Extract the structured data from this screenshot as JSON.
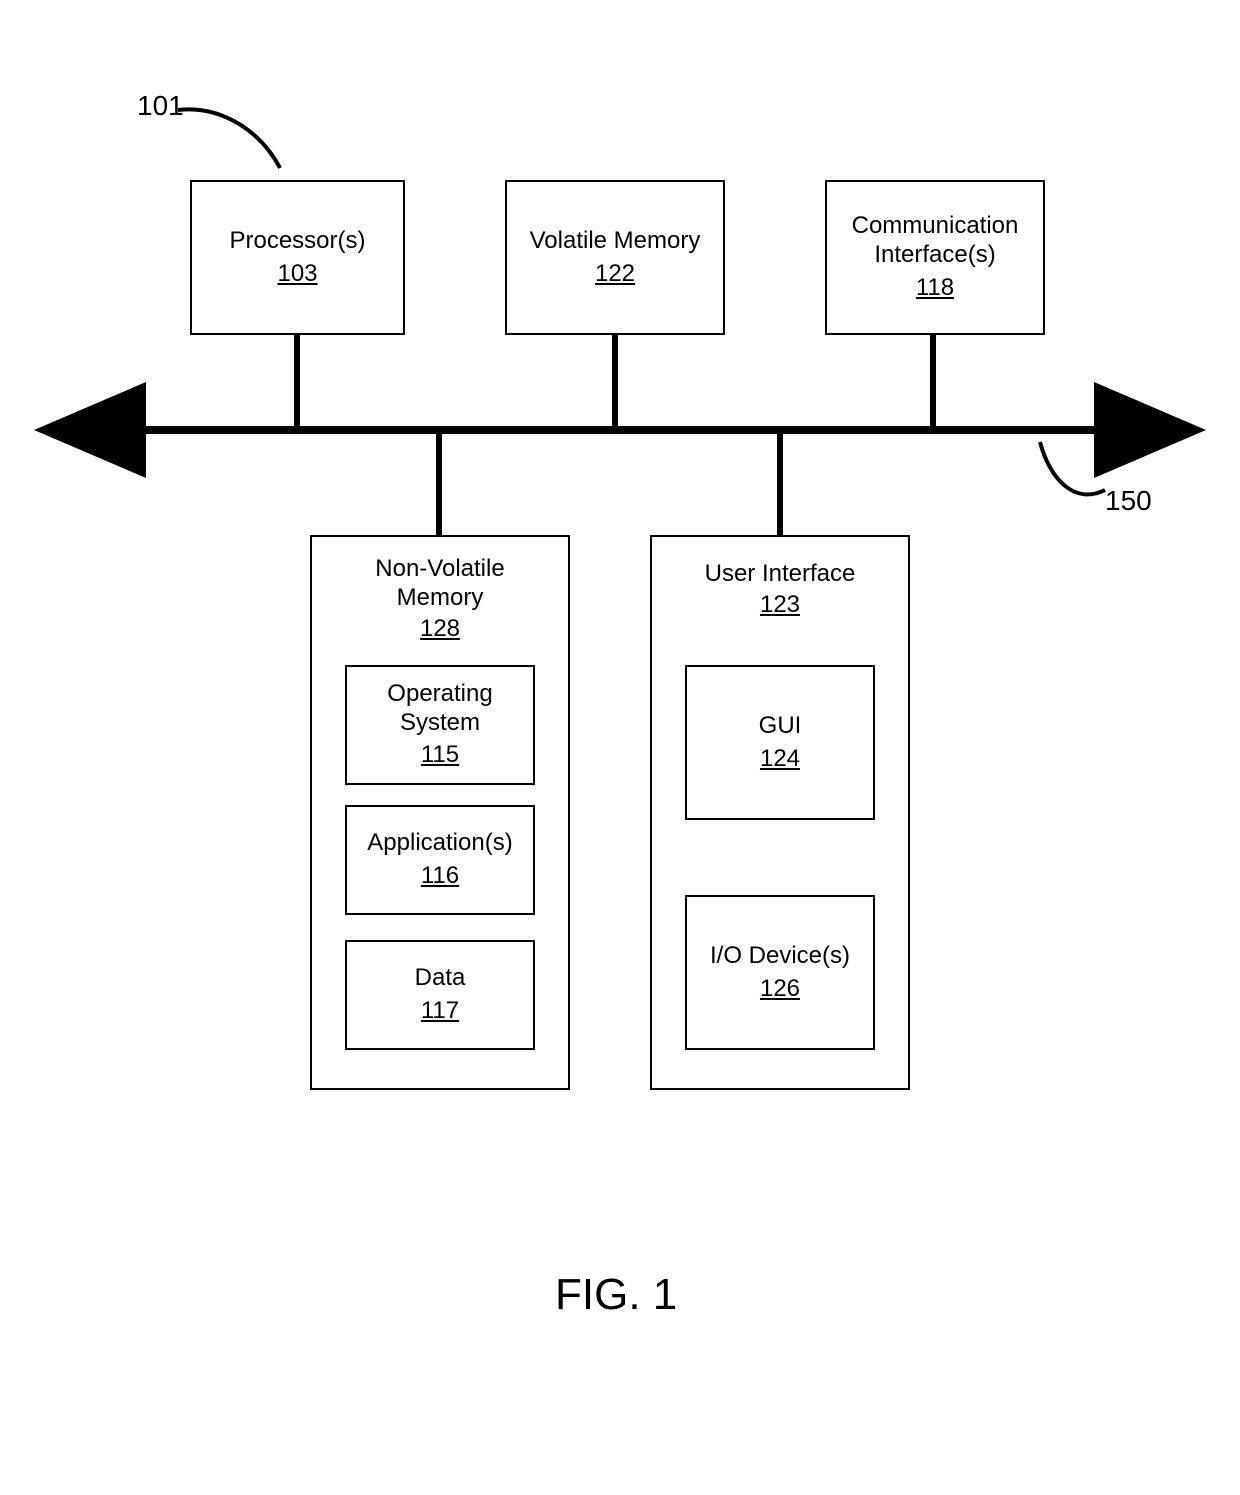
{
  "figure": {
    "caption": "FIG. 1",
    "system_ref": "101",
    "bus_ref": "150"
  },
  "top_blocks": {
    "processor": {
      "label": "Processor(s)",
      "ref": "103"
    },
    "volatile_memory": {
      "label": "Volatile Memory",
      "ref": "122"
    },
    "comm_interface": {
      "label1": "Communication",
      "label2": "Interface(s)",
      "ref": "118"
    }
  },
  "nvm": {
    "title1": "Non-Volatile",
    "title2": "Memory",
    "ref": "128",
    "os": {
      "label1": "Operating",
      "label2": "System",
      "ref": "115"
    },
    "apps": {
      "label": "Application(s)",
      "ref": "116"
    },
    "data": {
      "label": "Data",
      "ref": "117"
    }
  },
  "ui": {
    "title": "User Interface",
    "ref": "123",
    "gui": {
      "label": "GUI",
      "ref": "124"
    },
    "io": {
      "label": "I/O Device(s)",
      "ref": "126"
    }
  }
}
